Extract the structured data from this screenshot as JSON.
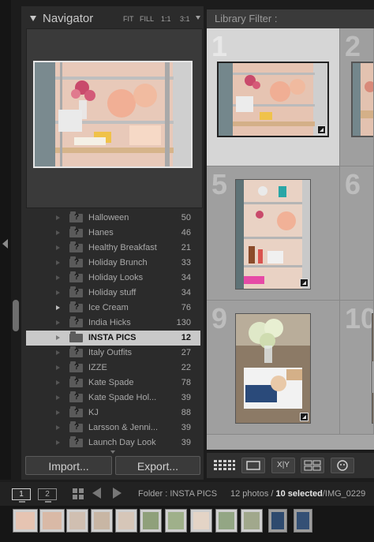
{
  "navigator": {
    "title": "Navigator",
    "zoom_options": [
      "FIT",
      "FILL",
      "1:1",
      "3:1"
    ]
  },
  "folders": [
    {
      "name": "Halloween",
      "count": "50"
    },
    {
      "name": "Hanes",
      "count": "46"
    },
    {
      "name": "Healthy Breakfast",
      "count": "21"
    },
    {
      "name": "Holiday Brunch",
      "count": "33"
    },
    {
      "name": "Holiday Looks",
      "count": "34"
    },
    {
      "name": "Holiday stuff",
      "count": "34"
    },
    {
      "name": "Ice Cream",
      "count": "76"
    },
    {
      "name": "India Hicks",
      "count": "130"
    },
    {
      "name": "INSTA PICS",
      "count": "12"
    },
    {
      "name": "Italy Outfits",
      "count": "27"
    },
    {
      "name": "IZZE",
      "count": "22"
    },
    {
      "name": "Kate Spade",
      "count": "78"
    },
    {
      "name": "Kate Spade Hol...",
      "count": "39"
    },
    {
      "name": "KJ",
      "count": "88"
    },
    {
      "name": "Larsson & Jenni...",
      "count": "39"
    },
    {
      "name": "Launch Day Look",
      "count": "39"
    }
  ],
  "folder_icon_glyph": "?",
  "buttons": {
    "import": "Import...",
    "export": "Export..."
  },
  "library_filter": {
    "label": "Library Filter :"
  },
  "grid_cells": [
    {
      "num": "1",
      "selected": true
    },
    {
      "num": "2",
      "selected": false
    },
    {
      "num": "5",
      "selected": false
    },
    {
      "num": "6",
      "selected": false
    },
    {
      "num": "9",
      "selected": false
    },
    {
      "num": "10",
      "selected": false
    }
  ],
  "toolbar": {
    "compare_label": "X|Y"
  },
  "filmstrip_bar": {
    "monitor_1": "1",
    "monitor_2": "2",
    "folder_text": "Folder : INSTA PICS",
    "count_prefix": "12 photos /",
    "selected_text": "10 selected",
    "file_text": "/IMG_0229"
  },
  "colors": {
    "panel_bg": "#2b2b2b",
    "grid_bg": "#a6a6a6",
    "selected_row": "#c9c9c9",
    "selected_cell": "#d6d6d6"
  }
}
